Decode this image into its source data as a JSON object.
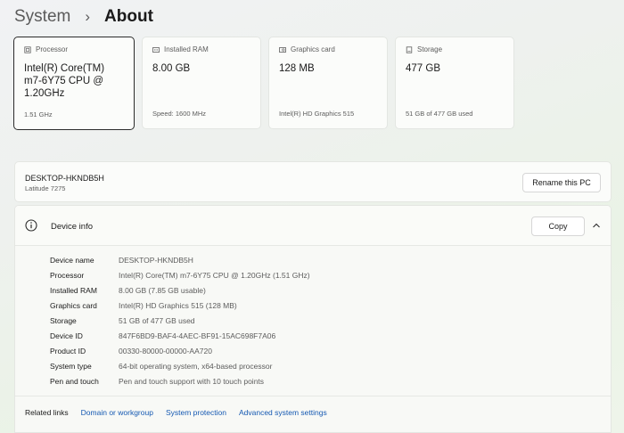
{
  "breadcrumb": {
    "parent": "System",
    "separator": "›",
    "current": "About"
  },
  "spec_cards": [
    {
      "label": "Processor",
      "value": "Intel(R) Core(TM) m7-6Y75 CPU @ 1.20GHz",
      "sub": "1.51 GHz",
      "icon": "processor-icon"
    },
    {
      "label": "Installed RAM",
      "value": "8.00 GB",
      "sub": "Speed: 1600 MHz",
      "icon": "ram-icon"
    },
    {
      "label": "Graphics card",
      "value": "128 MB",
      "sub": "Intel(R) HD Graphics 515",
      "icon": "graphics-card-icon"
    },
    {
      "label": "Storage",
      "value": "477 GB",
      "sub": "51 GB of 477 GB used",
      "icon": "storage-icon"
    }
  ],
  "pc": {
    "name": "DESKTOP-HKNDB5H",
    "model": "Latitude 7275",
    "rename_label": "Rename this PC"
  },
  "device_info": {
    "title": "Device info",
    "copy_label": "Copy",
    "rows": [
      {
        "label": "Device name",
        "value": "DESKTOP-HKNDB5H"
      },
      {
        "label": "Processor",
        "value": "Intel(R) Core(TM) m7-6Y75 CPU @ 1.20GHz (1.51 GHz)"
      },
      {
        "label": "Installed RAM",
        "value": "8.00 GB (7.85 GB usable)"
      },
      {
        "label": "Graphics card",
        "value": "Intel(R) HD Graphics 515 (128 MB)"
      },
      {
        "label": "Storage",
        "value": "51 GB of 477 GB used"
      },
      {
        "label": "Device ID",
        "value": "847F6BD9-BAF4-4AEC-BF91-15AC698F7A06"
      },
      {
        "label": "Product ID",
        "value": "00330-80000-00000-AA720"
      },
      {
        "label": "System type",
        "value": "64-bit operating system, x64-based processor"
      },
      {
        "label": "Pen and touch",
        "value": "Pen and touch support with 10 touch points"
      }
    ]
  },
  "related": {
    "title": "Related links",
    "links": [
      "Domain or workgroup",
      "System protection",
      "Advanced system settings"
    ]
  },
  "colors": {
    "link": "#1559b2",
    "selected_border": "#2b2b2b"
  }
}
